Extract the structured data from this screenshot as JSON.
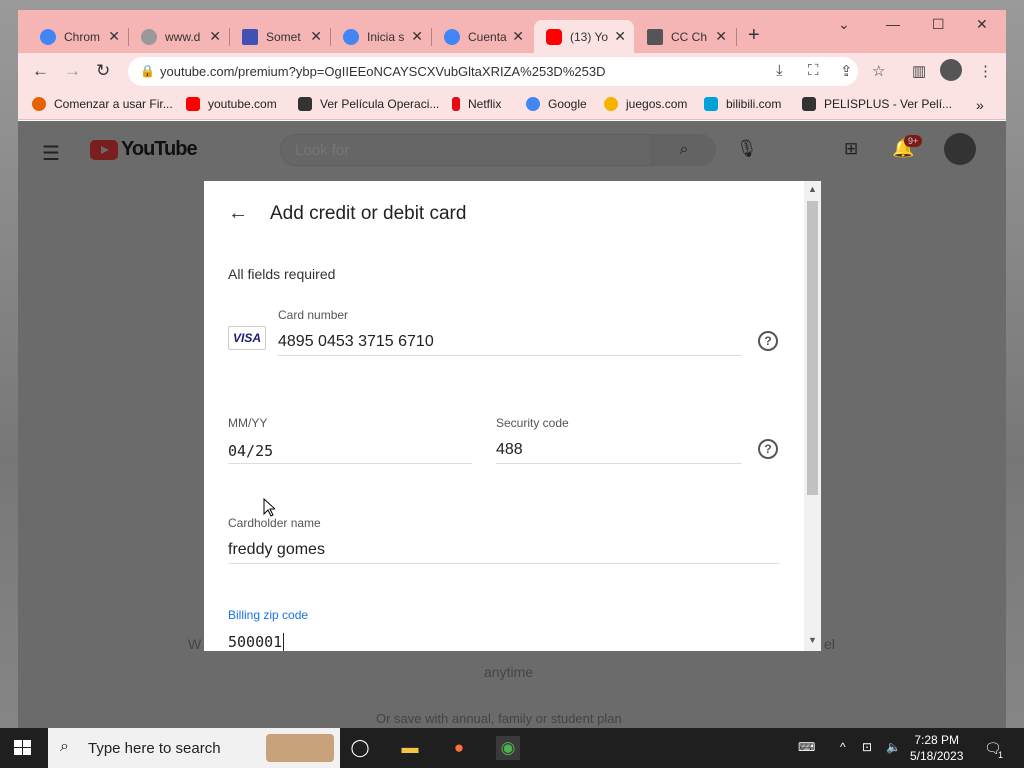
{
  "browser": {
    "tabs": [
      {
        "label": "Chrom",
        "color": "#4285f4"
      },
      {
        "label": "www.d",
        "color": "#888888"
      },
      {
        "label": "Somet",
        "color": "#3f51b5"
      },
      {
        "label": "Inicia s",
        "color": "#4285f4"
      },
      {
        "label": "Cuenta",
        "color": "#4285f4"
      },
      {
        "label": "(13) Yo",
        "color": "#ff0000"
      },
      {
        "label": "CC Ch",
        "color": "#555555"
      }
    ],
    "active_tab_index": 5,
    "url": "youtube.com/premium?ybp=OgIIEEoNCAYSCXVubGltaXRIZA%253D%253D",
    "bookmarks": [
      {
        "label": "Comenzar a usar Fir...",
        "color": "#e66000"
      },
      {
        "label": "youtube.com",
        "color": "#ff0000"
      },
      {
        "label": "Ver Película Operaci...",
        "color": "#333333"
      },
      {
        "label": "Netflix",
        "color": "#e50914"
      },
      {
        "label": "Google",
        "color": "#4285f4"
      },
      {
        "label": "juegos.com",
        "color": "#f4b400"
      },
      {
        "label": "bilibili.com",
        "color": "#00a1d6"
      },
      {
        "label": "PELISPLUS - Ver Pelí...",
        "color": "#333333"
      }
    ]
  },
  "youtube": {
    "logo_text": "YouTube",
    "search_placeholder": "Look for",
    "notification_count": "9+",
    "bg_line1_left": "W",
    "bg_line1_right": "el",
    "bg_line2": "anytime",
    "bg_line3": "Or save with annual, family or student plan"
  },
  "dialog": {
    "title": "Add credit or debit card",
    "required_note": "All fields required",
    "card_number_label": "Card number",
    "card_number": "4895 0453 3715 6710",
    "card_brand": "VISA",
    "expiry_label": "MM/YY",
    "expiry": "04/25",
    "security_label": "Security code",
    "security_code": "488",
    "cardholder_label": "Cardholder name",
    "cardholder": "freddy gomes",
    "zip_label": "Billing zip code",
    "zip": "500001"
  },
  "taskbar": {
    "search_placeholder": "Type here to search",
    "time": "7:28 PM",
    "date": "5/18/2023",
    "notif_count": "1"
  }
}
